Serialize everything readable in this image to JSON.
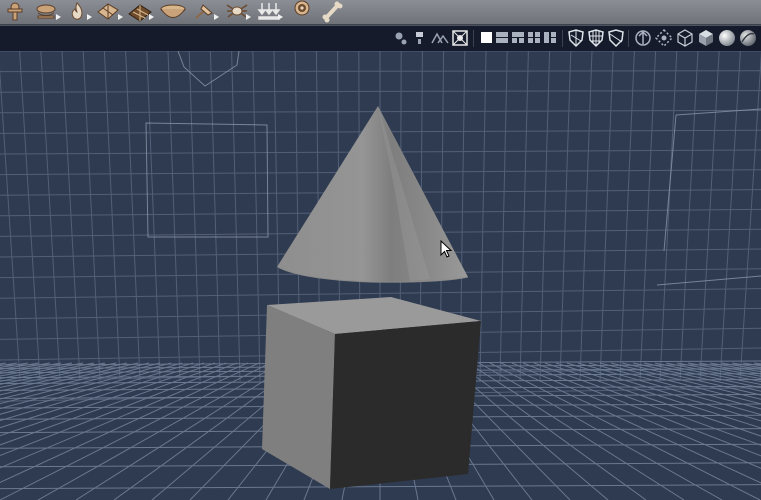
{
  "toolbar": {
    "tools": [
      {
        "name": "joint-tool-icon",
        "has_menu": false
      },
      {
        "name": "hair-tool-icon",
        "has_menu": true
      },
      {
        "name": "flame-tool-icon",
        "has_menu": true
      },
      {
        "name": "cloth-tool-icon",
        "has_menu": true
      },
      {
        "name": "bone-cage-tool-icon",
        "has_menu": true
      },
      {
        "name": "bowl-tool-icon",
        "has_menu": false
      },
      {
        "name": "pin-tool-icon",
        "has_menu": true
      },
      {
        "name": "spider-tool-icon",
        "has_menu": true
      },
      {
        "name": "ground-tool-icon",
        "has_menu": true
      },
      {
        "name": "target-tool-icon",
        "has_menu": false
      },
      {
        "name": "bone-tool-icon",
        "has_menu": false
      }
    ]
  },
  "view_toolbar": {
    "groups": [
      {
        "name": "camera-controls",
        "buttons": [
          "camera-orbit-icon",
          "camera-dolly-icon",
          "camera-pan-icon",
          "camera-frame-icon"
        ]
      },
      {
        "name": "layout-buttons",
        "buttons": [
          "layout-single-icon",
          "layout-two-row-icon",
          "layout-two-col-icon",
          "layout-four-icon",
          "layout-three-icon"
        ]
      },
      {
        "name": "shading-shield-buttons",
        "buttons": [
          "shield-wire-icon",
          "shield-grid-icon",
          "shield-outline-icon"
        ]
      },
      {
        "name": "render-mode-buttons",
        "buttons": [
          "vertex-mode-icon",
          "edge-mode-icon",
          "wireframe-cube-icon",
          "flat-cube-icon",
          "smooth-sphere-icon",
          "textured-sphere-icon"
        ]
      }
    ]
  },
  "colors": {
    "toolbar_bg": "#7d8086",
    "view_toolbar_bg": "#151b2a",
    "viewport_bg": "#2f3b50",
    "grid_line": "#5d6b84",
    "cone": "#8c8c8c",
    "box_front": "#2b2b2b",
    "box_side": "#7f7f7f",
    "box_top": "#9c9c9c"
  }
}
